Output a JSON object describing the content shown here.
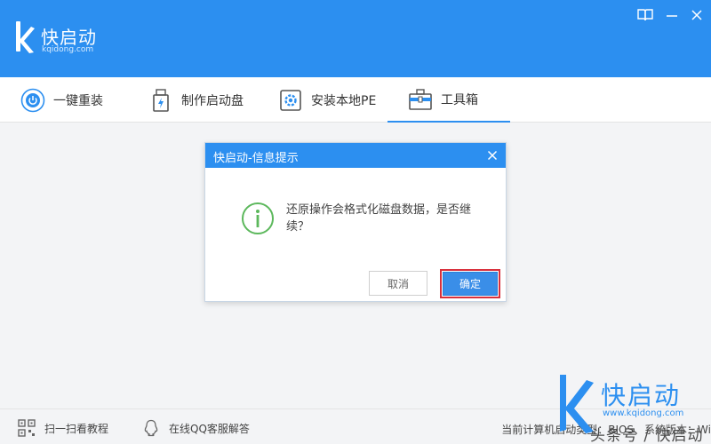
{
  "app": {
    "logo_title": "快启动",
    "logo_sub": "kqidong.com"
  },
  "tabs": [
    {
      "label": "一键重装",
      "icon": "power-icon"
    },
    {
      "label": "制作启动盘",
      "icon": "usb-drive-icon"
    },
    {
      "label": "安装本地PE",
      "icon": "gear-disk-icon"
    },
    {
      "label": "工具箱",
      "icon": "toolbox-icon",
      "active": true
    }
  ],
  "dialog": {
    "title": "快启动-信息提示",
    "message": "还原操作会格式化磁盘数据，是否继续？",
    "cancel_label": "取消",
    "ok_label": "确定",
    "icon": "info-icon"
  },
  "footer": {
    "tutorial_label": "扫一扫看教程",
    "support_label": "在线QQ客服解答",
    "status_text": "当前计算机启动类型：BIOS、系统版本：Wi"
  },
  "watermark": {
    "title": "快启动",
    "url": "www.kqidong.com",
    "credit": "头条号 / 快启动"
  },
  "colors": {
    "accent": "#2c8ff0",
    "highlight_border": "#d9303c",
    "info_green": "#5cb85c"
  }
}
